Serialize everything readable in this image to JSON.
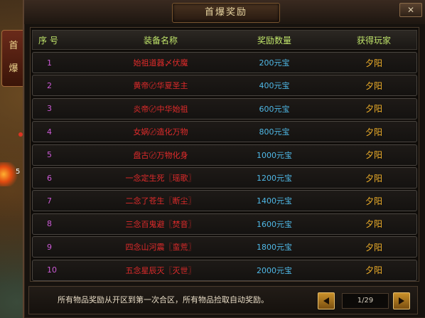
{
  "window": {
    "title": "首爆奖励",
    "close_label": "✕"
  },
  "side_tab": {
    "label_line1": "首",
    "label_line2": "爆"
  },
  "world": {
    "digit": "5"
  },
  "table": {
    "headers": {
      "index": "序 号",
      "name": "装备名称",
      "reward": "奖励数量",
      "player": "获得玩家"
    },
    "rows": [
      {
        "index": "1",
        "name": "始祖道器〆伏魔",
        "reward": "200元宝",
        "player": "夕阳"
      },
      {
        "index": "2",
        "name": "黄帝〄华夏圣主",
        "reward": "400元宝",
        "player": "夕阳"
      },
      {
        "index": "3",
        "name": "炎帝〄中华始祖",
        "reward": "600元宝",
        "player": "夕阳"
      },
      {
        "index": "4",
        "name": "女娲〄造化万物",
        "reward": "800元宝",
        "player": "夕阳"
      },
      {
        "index": "5",
        "name": "盘古〄万物化身",
        "reward": "1000元宝",
        "player": "夕阳"
      },
      {
        "index": "6",
        "name": "一念定生死〖瑶歌〗",
        "reward": "1200元宝",
        "player": "夕阳"
      },
      {
        "index": "7",
        "name": "二念了苍生〖断尘〗",
        "reward": "1400元宝",
        "player": "夕阳"
      },
      {
        "index": "8",
        "name": "三念百鬼避〖焚音〗",
        "reward": "1600元宝",
        "player": "夕阳"
      },
      {
        "index": "9",
        "name": "四念山河震〖蛮荒〗",
        "reward": "1800元宝",
        "player": "夕阳"
      },
      {
        "index": "10",
        "name": "五念星辰灭〖灭世〗",
        "reward": "2000元宝",
        "player": "夕阳"
      }
    ]
  },
  "footer": {
    "note": "所有物品奖励从开区到第一次合区，所有物品捡取自动奖励。",
    "page_indicator": "1/29",
    "prev_icon": "triangle-left-icon",
    "next_icon": "triangle-right-icon"
  },
  "colors": {
    "index": "#cc5ad6",
    "item_name": "#e02b2b",
    "reward": "#4fb8e6",
    "player": "#f0b02a",
    "header": "#bfe46a",
    "title": "#e9d6a2"
  }
}
